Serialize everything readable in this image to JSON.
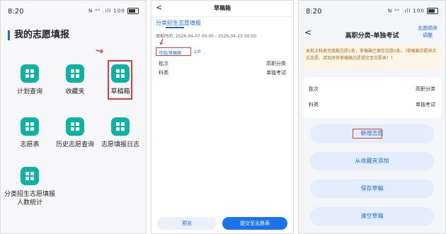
{
  "panel1": {
    "time": "8:20",
    "status_icons": "N ᵃᵃ .ıll 100",
    "title": "我的志愿填报",
    "items": [
      {
        "label": "计划查询"
      },
      {
        "label": "收藏夹"
      },
      {
        "label": "草稿箱"
      },
      {
        "label": "志愿表"
      },
      {
        "label": "历史志愿查询"
      },
      {
        "label": "志愿填报日志"
      },
      {
        "label": "分类招生志愿填报人数统计"
      }
    ]
  },
  "panel2": {
    "back": "<",
    "title": "草稿箱",
    "subtitle": "分类招生志愿填报",
    "time_range": "填报时间: 2026-04-07 00:00 - 2026-04-23 00:00",
    "status": "可填/草稿箱",
    "count": "1/0",
    "rows": [
      {
        "label": "批次",
        "value": "高职分类"
      },
      {
        "label": "科类",
        "value": "单独考试"
      }
    ],
    "preview_button": "预览",
    "submit_button": "提交至志愿表"
  },
  "panel3": {
    "time": "8:20",
    "status_icons": "N ᵃᵃ .ıll 100",
    "back": "<",
    "title": "高职分类-单独考试",
    "adjust_label": "志愿顺序调整",
    "notice": "本批次科类可填报志愿1条，草稿箱已保存志愿0条。（草稿箱志愿非正式志愿，请及时将草稿箱志愿提交至志愿表！）",
    "rows": [
      {
        "label": "批次",
        "value": "高职分类"
      },
      {
        "label": "科类",
        "value": "单独考试"
      }
    ],
    "buttons": {
      "add": "新增志愿",
      "from_favorites": "从收藏夹添加",
      "save": "保存草稿",
      "clear": "清空草稿"
    }
  },
  "colors": {
    "accent": "#1a73e8",
    "tile": "#0fb3a3",
    "highlight": "#e23b3b"
  }
}
